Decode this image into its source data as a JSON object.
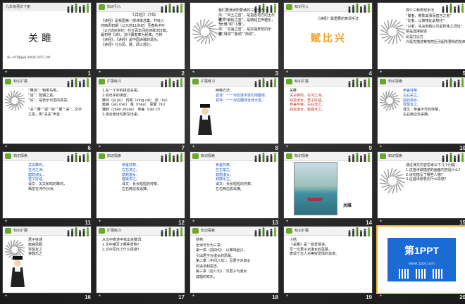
{
  "grade_label": "九年级语文下册",
  "slides": [
    {
      "n": "1",
      "title": "关雎",
      "sub": "第一PPT模板网-WWW.1PPT.COM"
    },
    {
      "n": "2",
      "header": "知识引入",
      "heading": "《诗经》介绍",
      "lines": [
        "《诗经》是我国第一部诗歌总集。共收入",
        "自西周初期（公元前11世纪）至春秋中叶",
        "（公元前6世纪）约五百年间的诗歌305篇，",
        "最初称《诗》，汉代儒者奉为经典，乃称",
        "《诗经》。《诗经》是中国诗歌的源头。",
        "《诗经》分为风、雅、颂三部分。"
      ]
    },
    {
      "n": "3",
      "lines": [
        "我们要读诗所要读的三部分为：",
        "风：“风土之音”，是指各地方的土乐歌谣。",
        "雅：“朝廷之音”，是朝廷正声雅乐，分",
        "“大雅”和“小雅”。",
        "颂：“宗庙之音”，是宗庙祭祀的乐歌，",
        "有“周颂”“鲁颂”“商颂”。"
      ]
    },
    {
      "n": "4",
      "header": "知识引入",
      "sub": "《诗经》最重要的表现手法",
      "big": "赋比兴"
    },
    {
      "n": "5",
      "lines": [
        "简介三种表现手法",
        "“赋者，敷陈其事而直言之者”",
        "“比者，以彼物比此物也”",
        "“兴者，先言他物以引起所咏之词也”",
        "赋是直接叙述",
        "比是打比方",
        "兴是先描述某物然后引起所要咏的东西"
      ]
    },
    {
      "n": "6",
      "header": "知识扩展",
      "lines": [
        "“雎鸠”：鸭类鸟类。",
        "“逑”：配偶之意。",
        "“好”：是表示可爱的意思。",
        "",
        "“关”“雎”“逑”“好”“服”“采”…文字",
        "之意，例“关关”声音"
      ]
    },
    {
      "n": "7",
      "header": "扩展练习",
      "lines": [
        "1.在一个字的拼音关系。",
        "2.标出字的读音。",
        "雎鸠（jū jiū）  荇菜（xìng cài）  流（liú）",
        "寤寐（wù mèi）  芼（mào）  思服（fú）",
        "辗转（zhǎn zhuǎn）  参差（cēn cī）",
        "3.将全篇诗句默写出来。"
      ]
    },
    {
      "n": "8",
      "header": "扩展练习",
      "lines": [
        "两种方法：",
        "直译：一一对应逐字逐句地翻译。",
        "意译：一一对应翻译全诗大意。"
      ]
    },
    {
      "n": "9",
      "header": "知识扩展",
      "lines": [
        "关雎",
        "关关雎鸠，在河之洲。",
        "窈窕淑女，君子好逑。",
        "参差荇菜，左右流之。",
        "窈窕淑女，寤寐求之。"
      ]
    },
    {
      "n": "10",
      "header": "知识探索",
      "lines": [
        "参差荇菜，",
        "左右采之。",
        "窈窕淑女，",
        "琴瑟友之。",
        "译文：参差不齐的荇菜，",
        "左右两边去采摘。"
      ]
    },
    {
      "n": "11",
      "header": "知识探索",
      "lines": [
        "关关雎鸠，",
        "在河之洲。",
        "窈窕淑女，",
        "君子好逑。",
        "译文：关关和鸣的雎鸠，",
        "栖息在河中沙洲。"
      ]
    },
    {
      "n": "12",
      "header": "知识探索",
      "lines": [
        "参差荇菜，",
        "左右流之。",
        "窈窕淑女，",
        "寤寐求之。",
        "译文：长长短短的荇菜，",
        "左右两边去采摘。"
      ]
    },
    {
      "n": "13",
      "header": "知识探索",
      "lines": [
        "参差荇菜，",
        "左右芼之。",
        "窈窕淑女，",
        "钟鼓乐之。",
        "译文：长长短短的荇菜，",
        "左右两边去采摘。"
      ]
    },
    {
      "n": "14",
      "header": "知识探索",
      "caption": "关雎"
    },
    {
      "n": "15",
      "header": "知识探索",
      "lines": [
        "通过课文内容思考以下几个问题：",
        "1.这首诗歌描述的画面内容是什么？",
        "2.诗句描写了哪些人物？",
        "3.这首诗想表达什么情感？"
      ]
    },
    {
      "n": "16",
      "header": "知识扩展",
      "lines": [
        "君子好逑",
        "寤寐思服",
        "琴瑟友之",
        "钟鼓乐之"
      ]
    },
    {
      "n": "17",
      "header": "扩展练习",
      "lines": [
        "从文中表述中找出关键词：",
        "1.文中描写了哪些景物？",
        "2.文中写出了什么情感？"
      ]
    },
    {
      "n": "18",
      "header": "知识探索",
      "lines": [
        "结构",
        "全诗可分为三章：",
        "第一章（前四句）：以雎鸠起兴，",
        "引出君子对淑女的思慕。",
        "第二章（中间八句）：写君子对淑女",
        "的追求和思念。",
        "第三章（后八句）：写君子与淑女",
        "成婚的欢乐。"
      ]
    },
    {
      "n": "19",
      "header": "知识扩展",
      "lines": [
        "小结",
        "《关雎》是一首爱情诗，",
        "写一位君子对淑女的思慕，",
        "表现了古人对美好爱情的追求。"
      ]
    },
    {
      "n": "20",
      "brand": "第1PPT",
      "brand_sub": "www.1ppt.com"
    }
  ],
  "colors": {
    "accent": "#6aa82a",
    "selection": "#f0b030"
  }
}
